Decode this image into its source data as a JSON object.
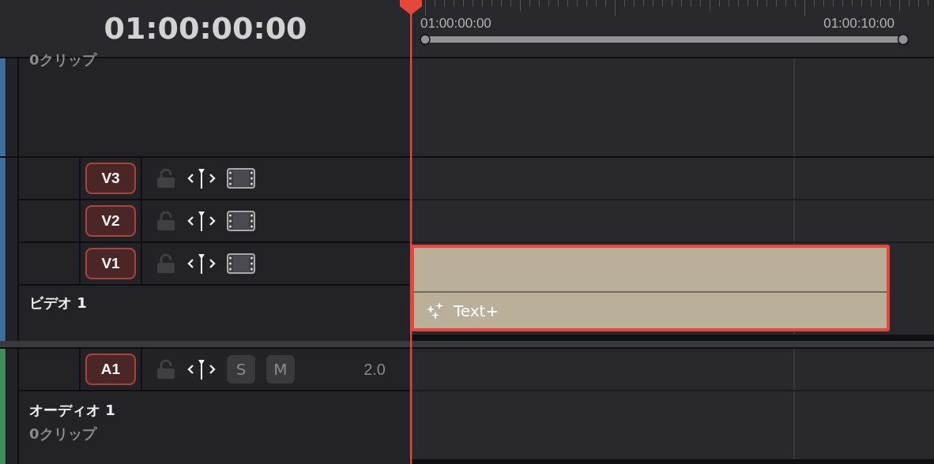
{
  "timecode": "01:00:00:00",
  "ruler": {
    "labels": [
      "01:00:00:00",
      "01:00:10:00"
    ]
  },
  "top_track": {
    "color": "#3d6e9e",
    "clip_count": "0クリップ"
  },
  "track_groups": [
    {
      "kind": "video",
      "color": "#3d6e9e",
      "name": "ビデオ 1",
      "tracks": [
        {
          "label": "V3"
        },
        {
          "label": "V2"
        },
        {
          "label": "V1"
        }
      ],
      "clip": {
        "title": "Text+",
        "selected": true
      }
    },
    {
      "kind": "audio",
      "color": "#3f8c5c",
      "name": "オーディオ 1",
      "clip_count": "0クリップ",
      "tracks": [
        {
          "label": "A1",
          "solo": "S",
          "mute": "M",
          "channels": "2.0"
        }
      ]
    }
  ]
}
